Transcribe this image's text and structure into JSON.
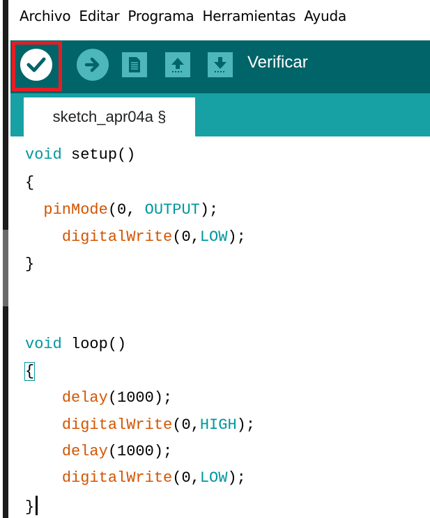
{
  "menu": [
    "Archivo",
    "Editar",
    "Programa",
    "Herramientas",
    "Ayuda"
  ],
  "toolbar": {
    "tooltip": "Verificar",
    "buttons": [
      "verify",
      "upload",
      "new",
      "open",
      "save"
    ],
    "colors": {
      "toolbar_bg": "#006468",
      "button_bg": "#4db7bb",
      "highlight": "#e51d25"
    }
  },
  "tab": {
    "label": "sketch_apr04a §"
  },
  "code": {
    "l1_kw": "void",
    "l1_rest": " setup()",
    "l2": "{",
    "l3_fn": "pinMode",
    "l3_a": "(0, ",
    "l3_const": "OUTPUT",
    "l3_b": ");",
    "l4_fn": "digitalWrite",
    "l4_a": "(0,",
    "l4_const": "LOW",
    "l4_b": ");",
    "l5": "}",
    "l6_kw": "void",
    "l6_rest": " loop()",
    "l7": "{",
    "l8_fn": "delay",
    "l8_a": "(1000);",
    "l9_fn": "digitalWrite",
    "l9_a": "(0,",
    "l9_const": "HIGH",
    "l9_b": ");",
    "l10_fn": "delay",
    "l10_a": "(1000);",
    "l11_fn": "digitalWrite",
    "l11_a": "(0,",
    "l11_const": "LOW",
    "l11_b": ");",
    "l12": "}"
  }
}
